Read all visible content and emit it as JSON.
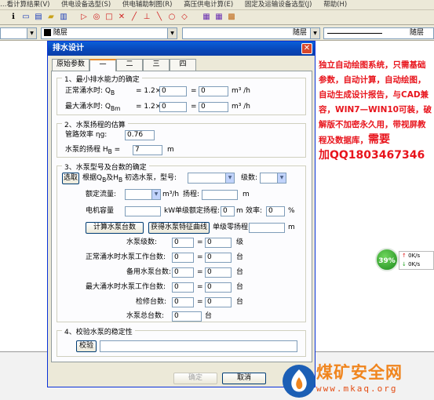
{
  "menubar": {
    "items": [
      "…看计算结果(V)",
      "供电设备选型(S)",
      "供电辅助制图(R)",
      "高压供电计算(E)",
      "固定及运输设备选型(J)",
      "帮助(H)"
    ]
  },
  "layer": {
    "color_label": "随层",
    "linetype_label": "随层",
    "lineweight_label": "随层"
  },
  "dialog": {
    "title": "排水设计",
    "close_label": "✕",
    "tabs": [
      "原始参数",
      "一",
      "二",
      "三",
      "四"
    ],
    "section1": {
      "title": "1、最小排水能力的确定",
      "normal_label": "正常涌水时: Q",
      "normal_sub": "B",
      "normal_expr": "= 1.2×",
      "normal_value": "0",
      "normal_result": "0",
      "max_label": "最大涌水时: Q",
      "max_sub": "Bm",
      "max_expr": "= 1.2×",
      "max_value": "0",
      "max_result": "0",
      "unit": "m³ /h",
      "eq": "="
    },
    "section2": {
      "title": "2、水泵扬程的估算",
      "eff_label": "管路效率 ηg:",
      "eff_value": "0.76",
      "head_label": "水泵的扬程 H",
      "head_sub": "B",
      "head_eq": "=",
      "head_value": "7",
      "head_unit": "m"
    },
    "section3": {
      "title": "3、水泵型号及台数的确定",
      "select_button": "选取",
      "basis_text": "根据Q",
      "basis_sub1": "B",
      "basis_mid": "及H",
      "basis_sub2": "B",
      "basis_tail": " 初选水泵，型号:",
      "stages_label": "级数:",
      "rated_flow_label": "额定流量:",
      "rated_flow_unit": "m³/h",
      "head_label": "扬程:",
      "head_unit": "m",
      "motor_label": "电机容量",
      "motor_unit": "kW",
      "single_head_label": "单级额定扬程:",
      "single_head_unit": "m",
      "efficiency_label": "效率:",
      "efficiency_unit": "%",
      "calc_button": "计算水泵台数",
      "curve_button": "获得水泵特征曲线",
      "zero_head_label": "单级零扬程:",
      "zero_head_unit": "m",
      "pump_stages_label": "水泵级数:",
      "pump_stages_value": "0",
      "pump_stages_result": "0",
      "pump_stages_unit": "级",
      "rows": [
        {
          "label": "正常涌水时水泵工作台数:",
          "value": "0",
          "result": "0",
          "unit": "台"
        },
        {
          "label": "备用水泵台数:",
          "value": "0",
          "result": "0",
          "unit": "台"
        },
        {
          "label": "最大涌水时水泵工作台数:",
          "value": "0",
          "result": "0",
          "unit": "台"
        },
        {
          "label": "检修台数:",
          "value": "0",
          "result": "0",
          "unit": "台"
        }
      ],
      "total_label": "水泵总台数:",
      "total_value": "0",
      "total_unit": "台"
    },
    "section4": {
      "title": "4、校验水泵的稳定性",
      "verify_button": "校验",
      "verify_value": ""
    },
    "ok_button": "确定",
    "cancel_button": "取消"
  },
  "ad": {
    "text": "独立自动绘图系统，只需基础参数，自动计算，自动绘图，自动生成设计报告，与CAD兼容，WIN7—WIN10可装，破解版不加密永久用，带视屏教程及数据库，",
    "contact_prefix": "需要",
    "contact": "加QQ1803467346"
  },
  "widget": {
    "percent": "39%",
    "up": "0K/s",
    "down": "0K/s"
  },
  "logo": {
    "name": "煤矿安全网",
    "url": "www.mkaq.org"
  },
  "colors": {
    "ad_red": "#e8141c",
    "title_blue": "#0846b8",
    "logo_orange": "#f0851e",
    "logo_blue": "#1c5fb5"
  }
}
